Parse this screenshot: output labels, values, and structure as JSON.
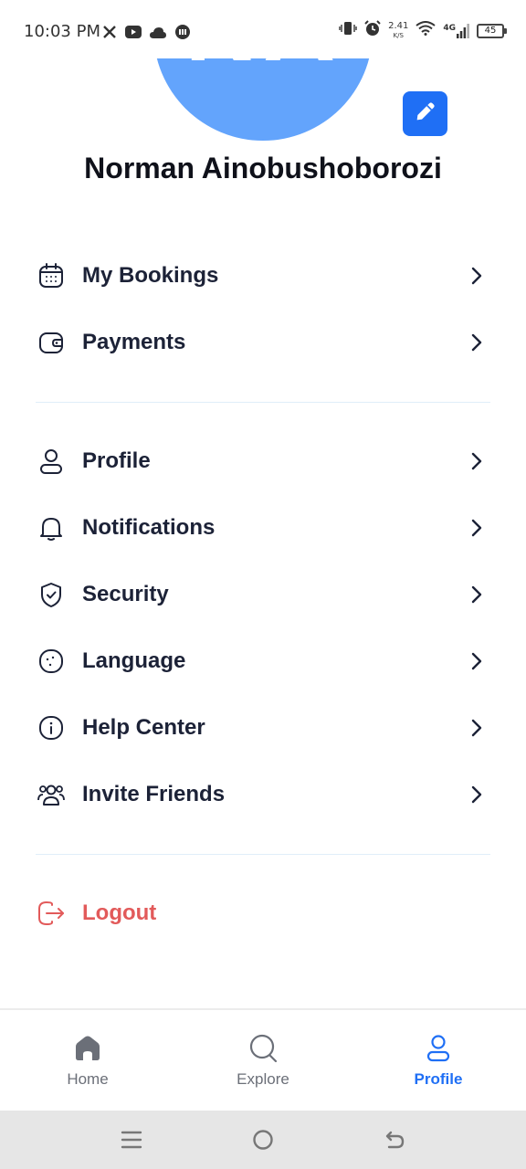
{
  "status_bar": {
    "time": "10:03 PM",
    "left_icons": [
      "x-icon",
      "youtube-icon",
      "cloud-icon",
      "app-icon"
    ],
    "net_speed": "2.41",
    "net_speed_unit": "K/S",
    "network_type": "4G",
    "battery": "45"
  },
  "profile": {
    "initials": "NA",
    "name": "Norman Ainobushoborozi",
    "avatar_color": "#63a4fc",
    "edit_icon": "pencil-icon"
  },
  "menu": {
    "group1": [
      {
        "label": "My Bookings",
        "icon": "calendar-icon"
      },
      {
        "label": "Payments",
        "icon": "wallet-icon"
      }
    ],
    "group2": [
      {
        "label": "Profile",
        "icon": "user-icon"
      },
      {
        "label": "Notifications",
        "icon": "bell-icon"
      },
      {
        "label": "Security",
        "icon": "shield-icon"
      },
      {
        "label": "Language",
        "icon": "globe-icon"
      },
      {
        "label": "Help Center",
        "icon": "info-icon"
      },
      {
        "label": "Invite Friends",
        "icon": "users-icon"
      }
    ],
    "logout": {
      "label": "Logout",
      "icon": "logout-icon",
      "color": "#e25a5a"
    }
  },
  "bottom_nav": {
    "items": [
      {
        "label": "Home",
        "icon": "home-icon"
      },
      {
        "label": "Explore",
        "icon": "search-icon"
      },
      {
        "label": "Profile",
        "icon": "user-icon",
        "active": true
      }
    ],
    "active_color": "#1f6ff5"
  },
  "system_nav": [
    "menu-icon",
    "home-circle-icon",
    "back-icon"
  ]
}
